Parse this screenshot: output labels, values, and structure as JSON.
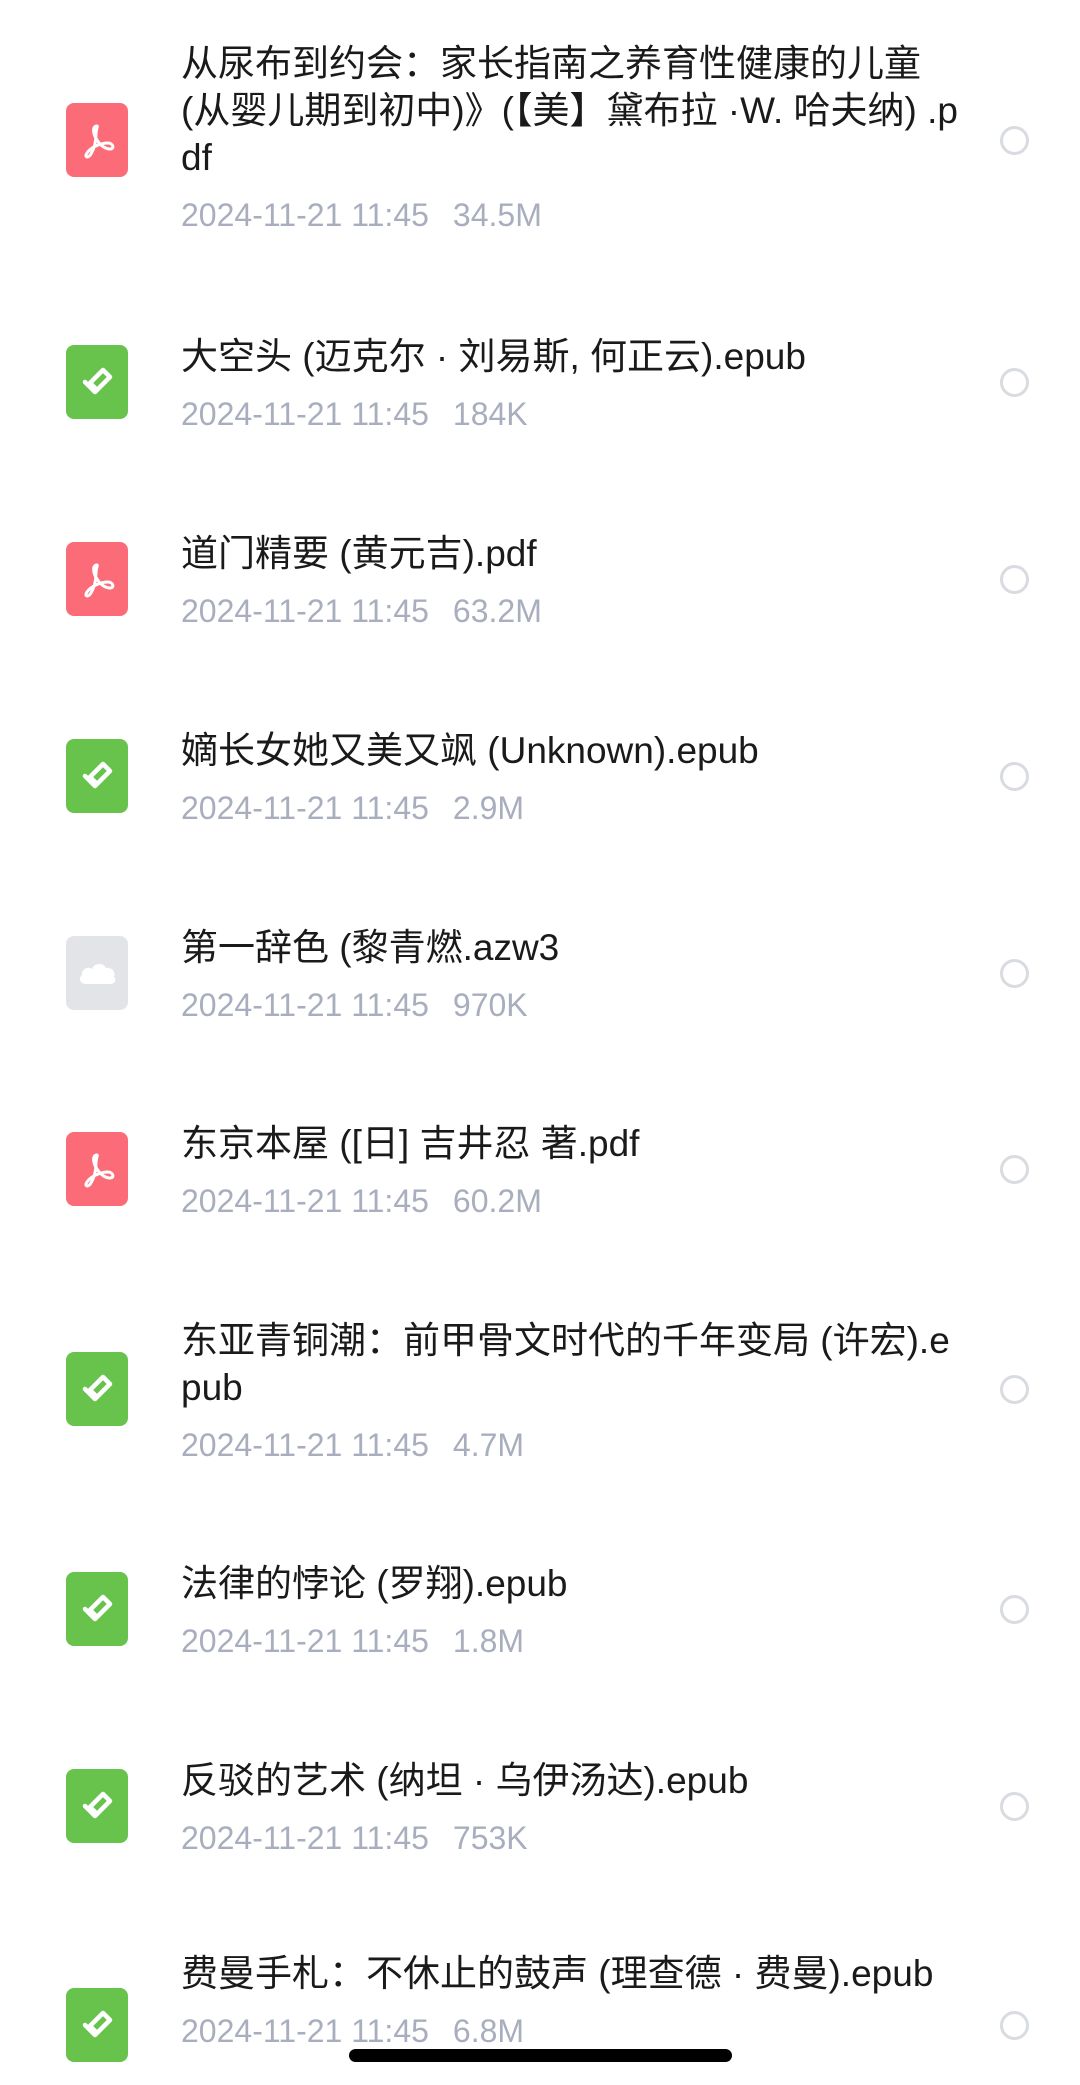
{
  "files": [
    {
      "name": "从尿布到约会：家长指南之养育性健康的儿童(从婴儿期到初中)》(【美】黛布拉 ·W. 哈夫纳) .pdf",
      "date": "2024-11-21 11:45",
      "size": "34.5M",
      "type": "pdf",
      "icon": "pdf-icon"
    },
    {
      "name": "大空头 (迈克尔 · 刘易斯, 何正云).epub",
      "date": "2024-11-21 11:45",
      "size": "184K",
      "type": "epub",
      "icon": "epub-icon"
    },
    {
      "name": "道门精要 (黄元吉).pdf",
      "date": "2024-11-21 11:45",
      "size": "63.2M",
      "type": "pdf",
      "icon": "pdf-icon"
    },
    {
      "name": "嫡长女她又美又飒 (Unknown).epub",
      "date": "2024-11-21 11:45",
      "size": "2.9M",
      "type": "epub",
      "icon": "epub-icon"
    },
    {
      "name": "第一辞色 (黎青燃.azw3",
      "date": "2024-11-21 11:45",
      "size": "970K",
      "type": "azw3",
      "icon": "cloud-file-icon"
    },
    {
      "name": "东京本屋 ([日] 吉井忍 著.pdf",
      "date": "2024-11-21 11:45",
      "size": "60.2M",
      "type": "pdf",
      "icon": "pdf-icon"
    },
    {
      "name": "东亚青铜潮：前甲骨文时代的千年变局 (许宏).epub",
      "date": "2024-11-21 11:45",
      "size": "4.7M",
      "type": "epub",
      "icon": "epub-icon"
    },
    {
      "name": "法律的悖论 (罗翔).epub",
      "date": "2024-11-21 11:45",
      "size": "1.8M",
      "type": "epub",
      "icon": "epub-icon"
    },
    {
      "name": "反驳的艺术 (纳坦 · 乌伊汤达).epub",
      "date": "2024-11-21 11:45",
      "size": "753K",
      "type": "epub",
      "icon": "epub-icon"
    },
    {
      "name": "费曼手札：不休止的鼓声 (理查德 · 费曼).epub",
      "date": "2024-11-21 11:45",
      "size": "6.8M",
      "type": "epub",
      "icon": "epub-icon"
    }
  ],
  "colors": {
    "pdf": "#fb6b78",
    "epub": "#67c34c",
    "azw3": "#e3e4e8",
    "meta_text": "#a8aebd",
    "radio_border": "#d8dbe0"
  }
}
